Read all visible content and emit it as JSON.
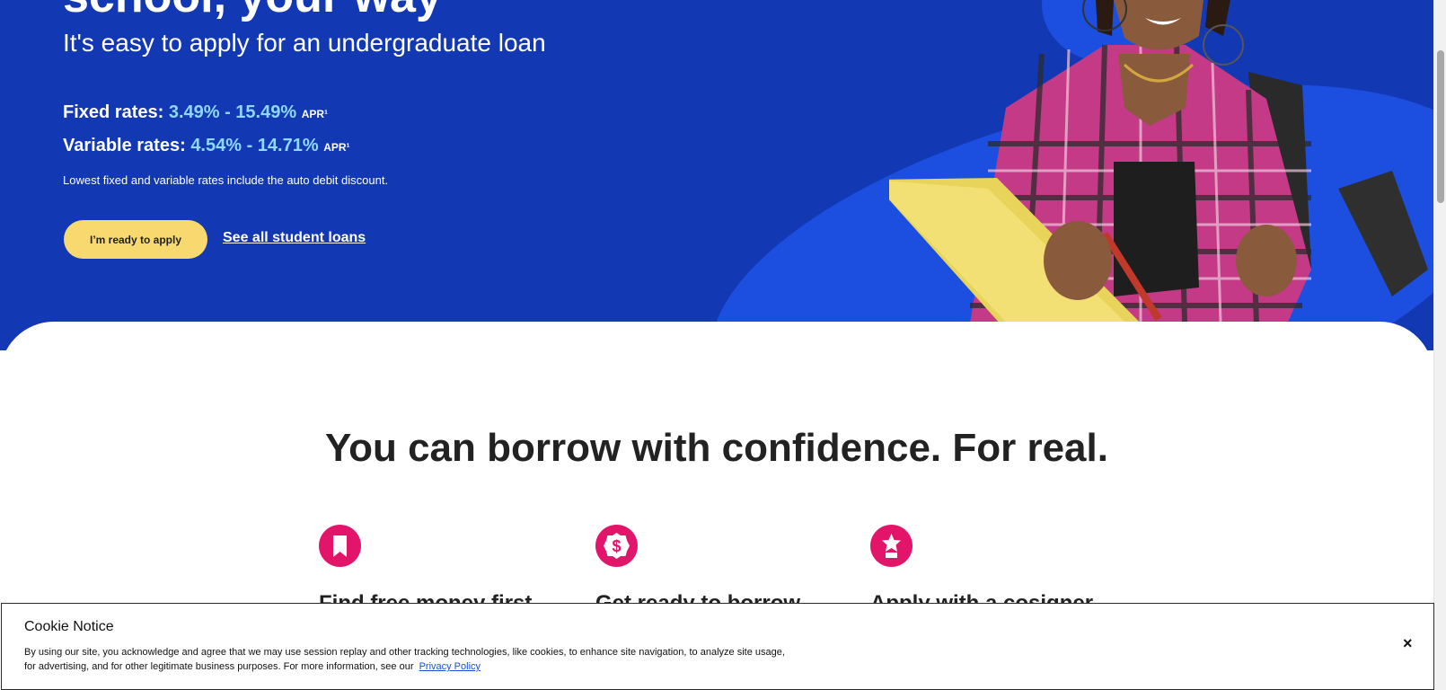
{
  "hero": {
    "title_partial": "school, your way",
    "subtitle": "It's easy to apply for an undergraduate loan",
    "fixed_label": "Fixed rates:",
    "fixed_value": "3.49% - 15.49%",
    "variable_label": "Variable rates:",
    "variable_value": "4.54% - 14.71%",
    "rate_unit": "APR¹",
    "note": "Lowest fixed and variable rates include the auto debit discount.",
    "apply_button": "I’m ready to apply",
    "see_all_link": "See all student loans"
  },
  "section": {
    "title": "You can borrow with confidence. For real.",
    "features": [
      {
        "icon": "bookmark-icon",
        "title": "Find free money first"
      },
      {
        "icon": "dollar-badge-icon",
        "title": "Get ready to borrow"
      },
      {
        "icon": "star-award-icon",
        "title": "Apply with a cosigner"
      }
    ]
  },
  "cookie_notice": {
    "title": "Cookie Notice",
    "body": "By using our site, you acknowledge and agree that we may use session replay and other tracking technologies, like cookies, to enhance site navigation, to analyze site usage, for advertising, and for other legitimate business purposes. For more information, see our",
    "link": "Privacy Policy",
    "close": "×"
  },
  "colors": {
    "hero_bg": "#1238b4",
    "rate_highlight": "#8fd8ff",
    "button_yellow": "#f8d970",
    "icon_pink": "#e3156b"
  }
}
